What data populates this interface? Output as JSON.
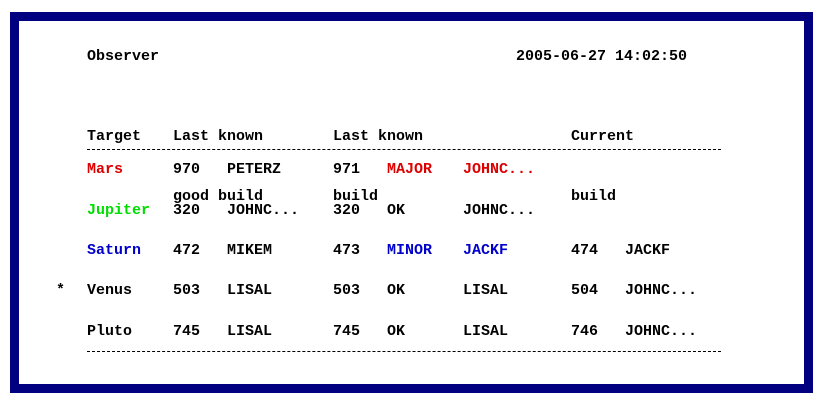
{
  "screen": {
    "title": "Observer",
    "timestamp": "2005-06-27 14:02:50"
  },
  "headers": {
    "target": "Target",
    "last_good_line1": "Last known",
    "last_good_line2": "good build",
    "last_known_line1": "Last known",
    "last_known_line2": "build",
    "current_line1": "Current",
    "current_line2": "build"
  },
  "colors": {
    "frame": "#000080",
    "default": "#000000",
    "major": "#dd0000",
    "ok": "#000000",
    "minor": "#0000cc",
    "jupiter": "#00dd00"
  },
  "rows": [
    {
      "marker": "",
      "target": "Mars",
      "target_color": "#dd0000",
      "last_good_build": "970",
      "last_good_user": "PETERZ",
      "last_known_build": "971",
      "last_known_status": "MAJOR",
      "last_known_user": "JOHNC...",
      "status_color": "#dd0000",
      "current_build": "",
      "current_user": ""
    },
    {
      "marker": "",
      "target": "Jupiter",
      "target_color": "#00dd00",
      "last_good_build": "320",
      "last_good_user": "JOHNC...",
      "last_known_build": "320",
      "last_known_status": "OK",
      "last_known_user": "JOHNC...",
      "status_color": "#000000",
      "current_build": "",
      "current_user": ""
    },
    {
      "marker": "",
      "target": "Saturn",
      "target_color": "#0000cc",
      "last_good_build": "472",
      "last_good_user": "MIKEM",
      "last_known_build": "473",
      "last_known_status": "MINOR",
      "last_known_user": "JACKF",
      "status_color": "#0000cc",
      "current_build": "474",
      "current_user": "JACKF"
    },
    {
      "marker": "*",
      "target": "Venus",
      "target_color": "#000000",
      "last_good_build": "503",
      "last_good_user": "LISAL",
      "last_known_build": "503",
      "last_known_status": "OK",
      "last_known_user": "LISAL",
      "status_color": "#000000",
      "current_build": "504",
      "current_user": "JOHNC..."
    },
    {
      "marker": "",
      "target": "Pluto",
      "target_color": "#000000",
      "last_good_build": "745",
      "last_good_user": "LISAL",
      "last_known_build": "745",
      "last_known_status": "OK",
      "last_known_user": "LISAL",
      "status_color": "#000000",
      "current_build": "746",
      "current_user": "JOHNC..."
    }
  ]
}
